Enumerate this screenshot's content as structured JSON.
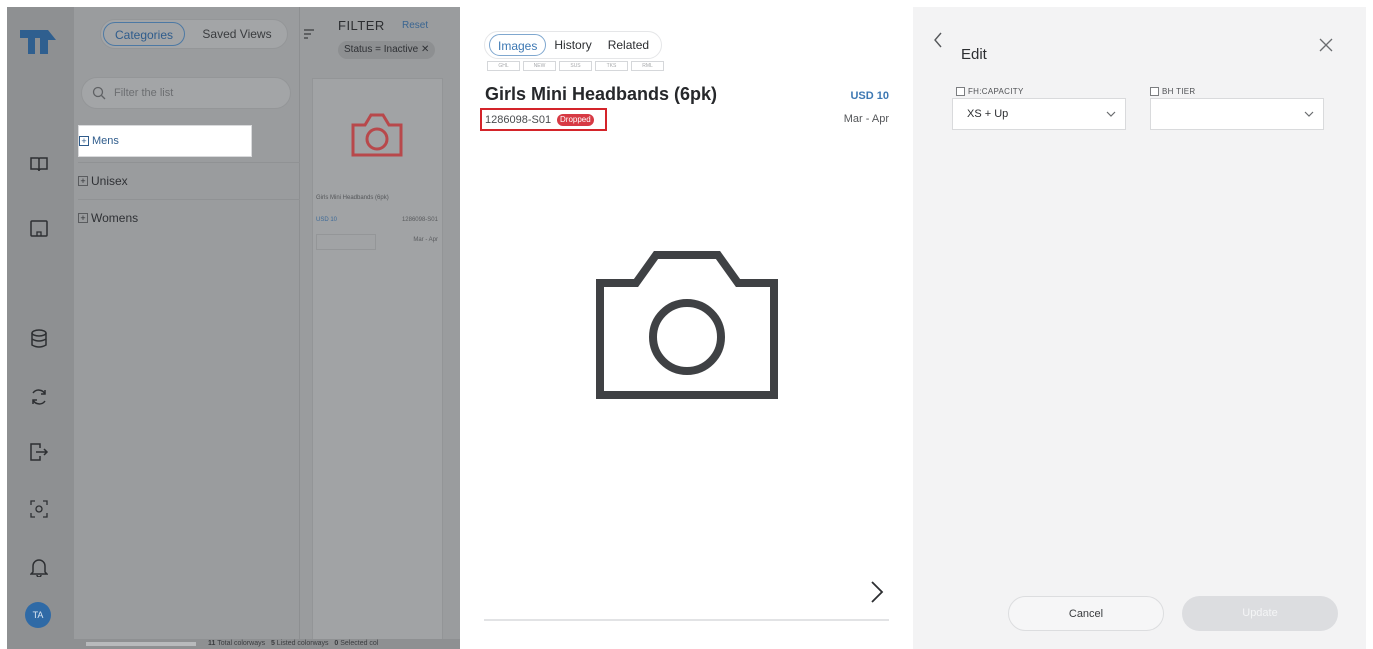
{
  "nav": {
    "icons": [
      "logo",
      "book-icon",
      "board-icon",
      "database-icon",
      "sync-icon",
      "export-icon",
      "scan-icon",
      "bell-icon"
    ],
    "avatar": "TA"
  },
  "categories_panel": {
    "tabs": [
      "Categories",
      "Saved Views"
    ],
    "active_tab": "Categories",
    "search_placeholder": "Filter the list",
    "tree": [
      {
        "label": "Mens",
        "selected": true
      },
      {
        "label": "Unisex",
        "selected": false
      },
      {
        "label": "Womens",
        "selected": false
      }
    ]
  },
  "filter": {
    "title": "FILTER",
    "reset": "Reset",
    "chip": "Status = Inactive"
  },
  "result_card": {
    "name": "Girls Mini Headbands (6pk)",
    "price": "USD 10",
    "sku": "1286098-S01",
    "season": "Mar - Apr"
  },
  "footer": {
    "total": "11",
    "total_label": "Total colorways",
    "listed": "5",
    "listed_label": "Listed colorways",
    "selected": "0",
    "selected_label": "Selected col"
  },
  "detail": {
    "tabs": [
      "Images",
      "History",
      "Related"
    ],
    "active_tab": "Images",
    "badges": [
      "GHL",
      "NEW",
      "SUS",
      "TKS",
      "RML"
    ],
    "title": "Girls Mini Headbands (6pk)",
    "price": "USD 10",
    "sku": "1286098-S01",
    "status": "Dropped",
    "season": "Mar - Apr"
  },
  "edit": {
    "title": "Edit",
    "fields": [
      {
        "label": "FH:CAPACITY",
        "value": "XS + Up"
      },
      {
        "label": "BH TIER",
        "value": ""
      }
    ],
    "cancel": "Cancel",
    "update": "Update"
  },
  "colors": {
    "accent": "#3d78b3",
    "dropped": "#d73a44",
    "highlight": "#d4242a",
    "overlay": "#9a9c9e"
  }
}
